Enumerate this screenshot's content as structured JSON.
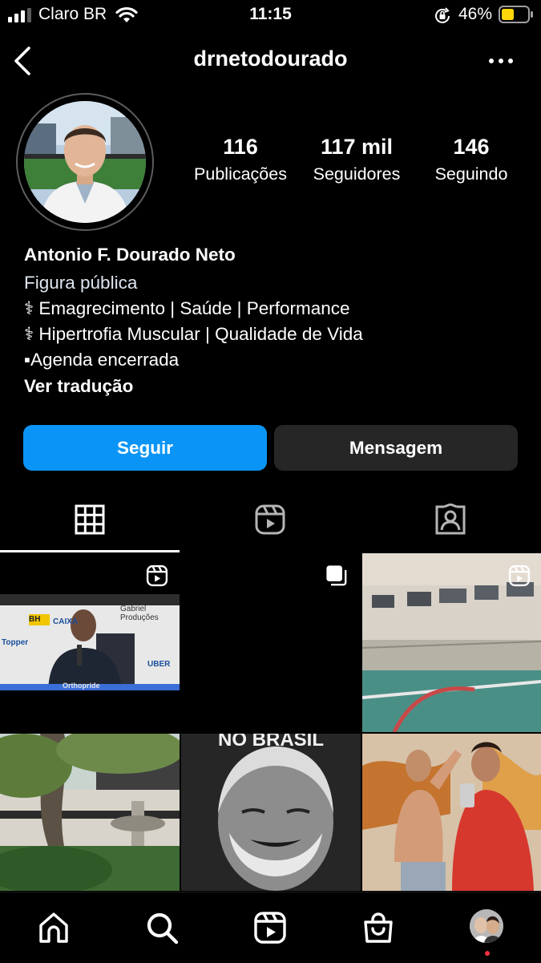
{
  "status_bar": {
    "carrier": "Claro BR",
    "time": "11:15",
    "battery_percent": "46%",
    "icons": [
      "signal-icon",
      "wifi-icon",
      "orientation-lock-icon",
      "battery-icon"
    ]
  },
  "header": {
    "username": "drnetodourado",
    "back_icon": "chevron-left-icon",
    "more_icon": "ellipsis-icon"
  },
  "stats": [
    {
      "number": "116",
      "label": "Publicações"
    },
    {
      "number": "117 mil",
      "label": "Seguidores"
    },
    {
      "number": "146",
      "label": "Seguindo"
    }
  ],
  "bio": {
    "name": "Antonio F. Dourado Neto",
    "category": "Figura pública",
    "lines": [
      "⚕ Emagrecimento | Saúde | Performance",
      "⚕ Hipertrofia Muscular | Qualidade de Vida",
      "▪Agenda encerrada"
    ],
    "translate": "Ver tradução"
  },
  "actions": {
    "follow": "Seguir",
    "message": "Mensagem"
  },
  "tabs": [
    {
      "icon": "grid-icon",
      "active": true
    },
    {
      "icon": "reels-icon",
      "active": false
    },
    {
      "icon": "tagged-icon",
      "active": false
    }
  ],
  "posts": [
    {
      "type": "reel",
      "overlay_text": {
        "banner": "Gabriel Produções",
        "sponsors": [
          "BH",
          "CAIXA",
          "Topper",
          "UBER",
          "Orthopride"
        ]
      }
    },
    {
      "type": "carousel"
    },
    {
      "type": "reel"
    },
    {
      "type": "image"
    },
    {
      "type": "image",
      "overlay_text": {
        "caption": "NO BRASIL"
      }
    },
    {
      "type": "image"
    }
  ],
  "bottom_nav": [
    "home-icon",
    "search-icon",
    "reels-icon",
    "shop-icon",
    "profile-avatar"
  ],
  "colors": {
    "background": "#000000",
    "follow_button": "#0a95f6",
    "message_button": "#262626",
    "notification_dot": "#ff3040"
  }
}
